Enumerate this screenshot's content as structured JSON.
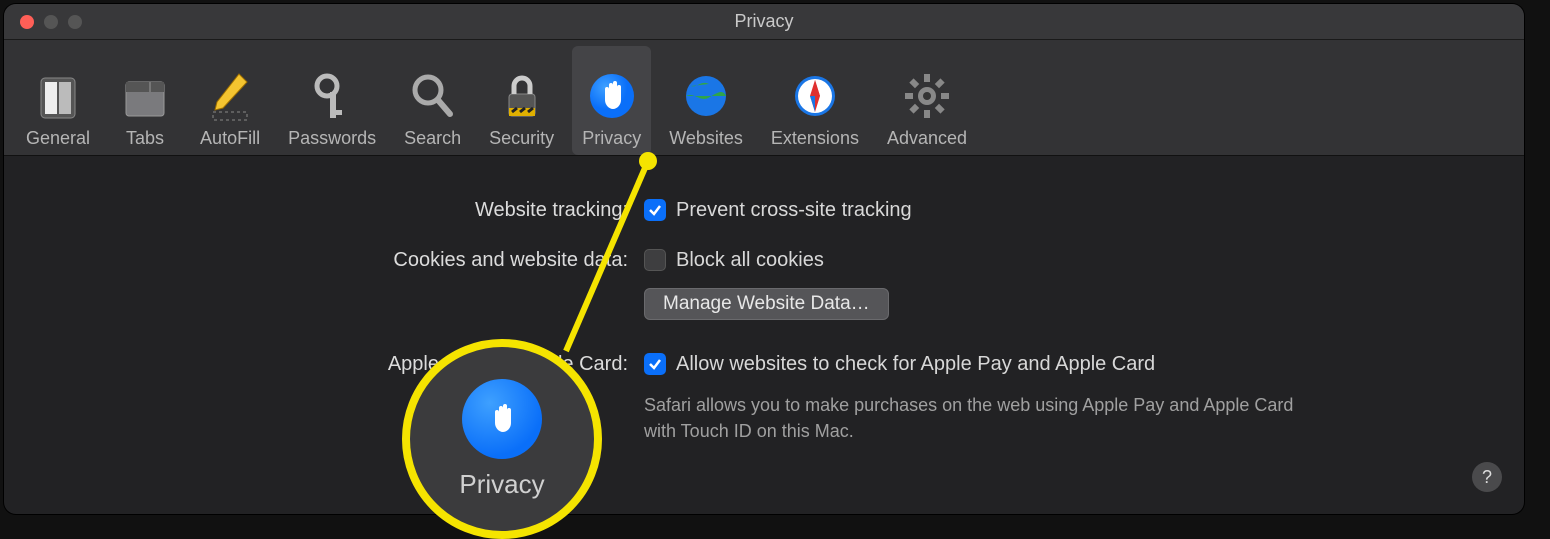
{
  "window": {
    "title": "Privacy"
  },
  "toolbar": {
    "items": [
      {
        "key": "general",
        "label": "General"
      },
      {
        "key": "tabs",
        "label": "Tabs"
      },
      {
        "key": "autofill",
        "label": "AutoFill"
      },
      {
        "key": "passwords",
        "label": "Passwords"
      },
      {
        "key": "search",
        "label": "Search"
      },
      {
        "key": "security",
        "label": "Security"
      },
      {
        "key": "privacy",
        "label": "Privacy"
      },
      {
        "key": "websites",
        "label": "Websites"
      },
      {
        "key": "extensions",
        "label": "Extensions"
      },
      {
        "key": "advanced",
        "label": "Advanced"
      }
    ],
    "active_key": "privacy"
  },
  "sections": {
    "tracking": {
      "label": "Website tracking:",
      "checkbox_label": "Prevent cross-site tracking",
      "checked": true
    },
    "cookies": {
      "label": "Cookies and website data:",
      "checkbox_label": "Block all cookies",
      "checked": false,
      "button_label": "Manage Website Data…"
    },
    "applepay": {
      "label": "Apple Pay and Apple Card:",
      "checkbox_label": "Allow websites to check for Apple Pay and Apple Card",
      "checked": true,
      "description": "Safari allows you to make purchases on the web using Apple Pay and Apple Card with Touch ID on this Mac."
    }
  },
  "help": {
    "label": "?"
  },
  "callout": {
    "zoom_label": "Privacy"
  }
}
